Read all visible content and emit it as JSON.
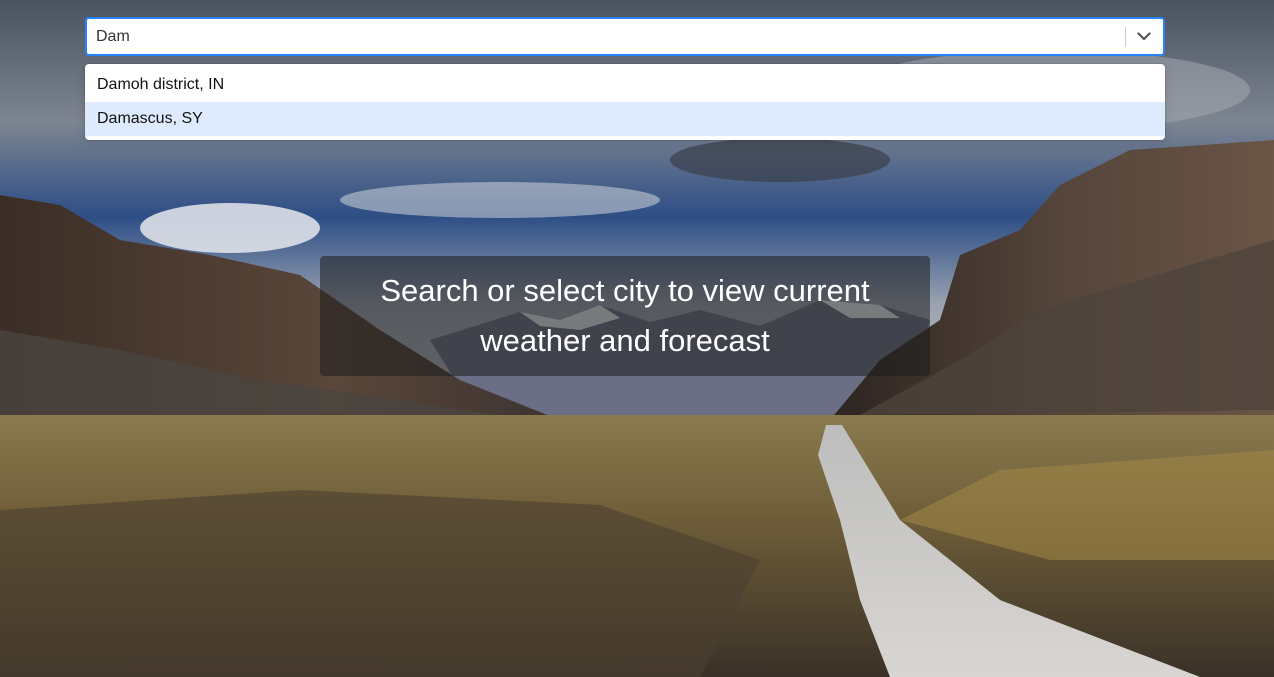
{
  "search": {
    "value": "Dam",
    "accent_color": "#2684ff"
  },
  "dropdown": {
    "toggle_icon": "chevron-down-icon",
    "options": [
      {
        "label": "Damoh district, IN",
        "focused": false
      },
      {
        "label": "Damascus, SY",
        "focused": true
      }
    ],
    "focused_color": "#deebff"
  },
  "hero": {
    "message": "Search or select city to view current weather and forecast"
  },
  "background": {
    "scene": "landscape-photo"
  }
}
